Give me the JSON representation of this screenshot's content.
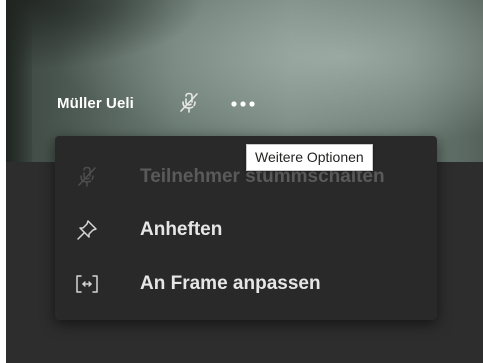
{
  "participant": {
    "name": "Müller Ueli"
  },
  "tooltip": {
    "text": "Weitere Optionen"
  },
  "menu": {
    "items": [
      {
        "label": "Teilnehmer stummschalten",
        "icon": "mic-off-icon",
        "disabled": true
      },
      {
        "label": "Anheften",
        "icon": "pin-icon",
        "disabled": false
      },
      {
        "label": "An Frame anpassen",
        "icon": "fit-to-frame-icon",
        "disabled": false
      }
    ]
  },
  "icons": {
    "participant_status": "mic-off-icon",
    "more": "more-options-icon"
  },
  "colors": {
    "menu_background": "#292929",
    "stage_background": "#2d2d2d",
    "text": "#e6e6e6",
    "disabled_text": "#5a5a5a",
    "tooltip_background": "#ffffff"
  }
}
